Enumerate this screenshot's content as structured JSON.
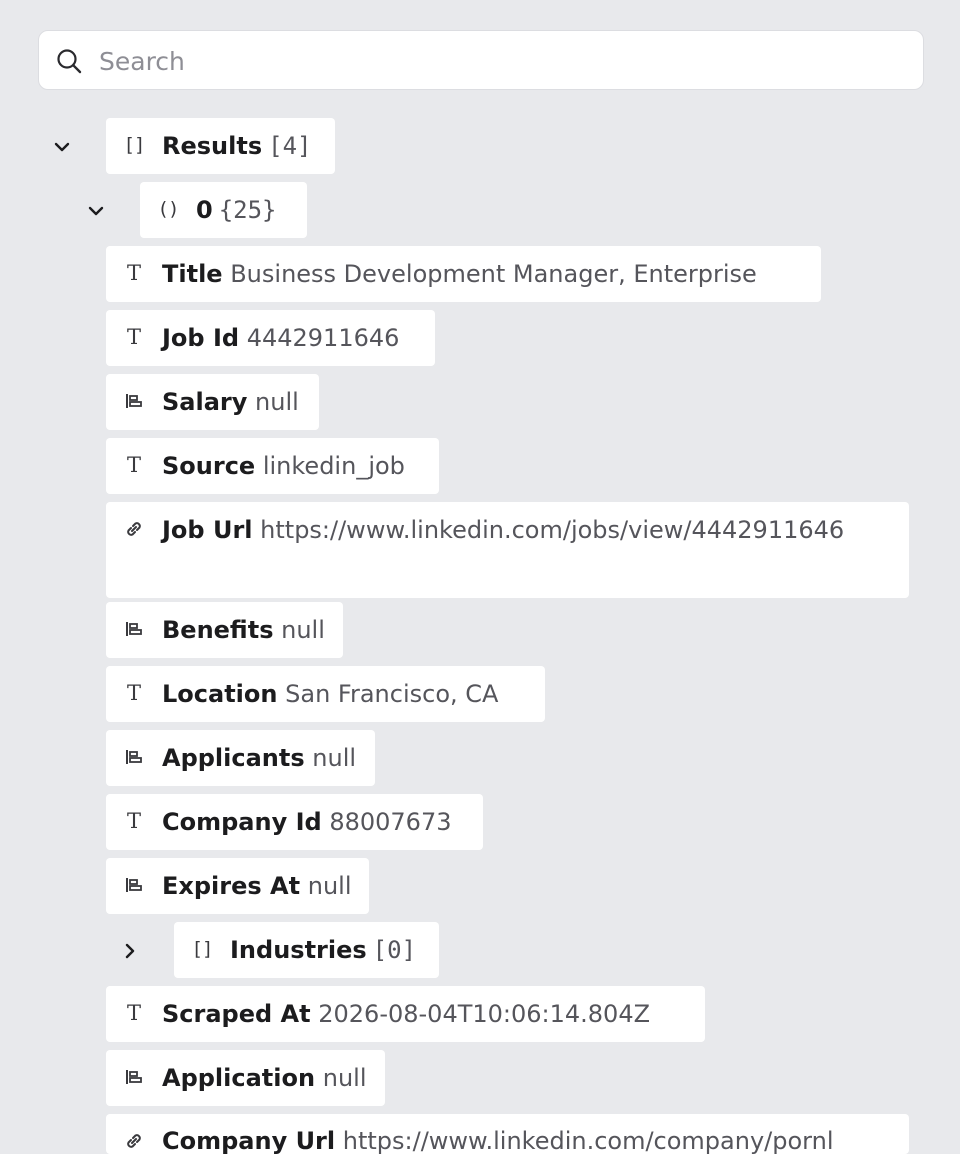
{
  "search": {
    "placeholder": "Search",
    "icon": "search-icon"
  },
  "tree": {
    "root": {
      "key": "Results",
      "count": "[4]",
      "type_icon": "array-icon",
      "expanded": true
    },
    "item0": {
      "key": "0",
      "count": "{25}",
      "type_icon": "object-icon",
      "expanded": true
    },
    "fields": [
      {
        "key": "Title",
        "value": "Business Development Manager, Enterprise",
        "type_icon": "text-type-icon"
      },
      {
        "key": "Job Id",
        "value": "4442911646",
        "type_icon": "text-type-icon"
      },
      {
        "key": "Salary",
        "value": "null",
        "type_icon": "null-type-icon"
      },
      {
        "key": "Source",
        "value": "linkedin_job",
        "type_icon": "text-type-icon"
      },
      {
        "key": "Job Url",
        "value": "https://www.linkedin.com/jobs/view/4442911646",
        "type_icon": "link-type-icon"
      },
      {
        "key": "Benefits",
        "value": "null",
        "type_icon": "null-type-icon"
      },
      {
        "key": "Location",
        "value": "San Francisco, CA",
        "type_icon": "text-type-icon"
      },
      {
        "key": "Applicants",
        "value": "null",
        "type_icon": "null-type-icon"
      },
      {
        "key": "Company Id",
        "value": "88007673",
        "type_icon": "text-type-icon"
      },
      {
        "key": "Expires At",
        "value": "null",
        "type_icon": "null-type-icon"
      },
      {
        "key": "Industries",
        "count": "[0]",
        "type_icon": "array-icon",
        "expanded": false
      },
      {
        "key": "Scraped At",
        "value": "2026-08-04T10:06:14.804Z",
        "type_icon": "text-type-icon"
      },
      {
        "key": "Application",
        "value": "null",
        "type_icon": "null-type-icon"
      },
      {
        "key": "Company Url",
        "value": "https://www.linkedin.com/company/pornl",
        "type_icon": "link-type-icon"
      }
    ]
  }
}
